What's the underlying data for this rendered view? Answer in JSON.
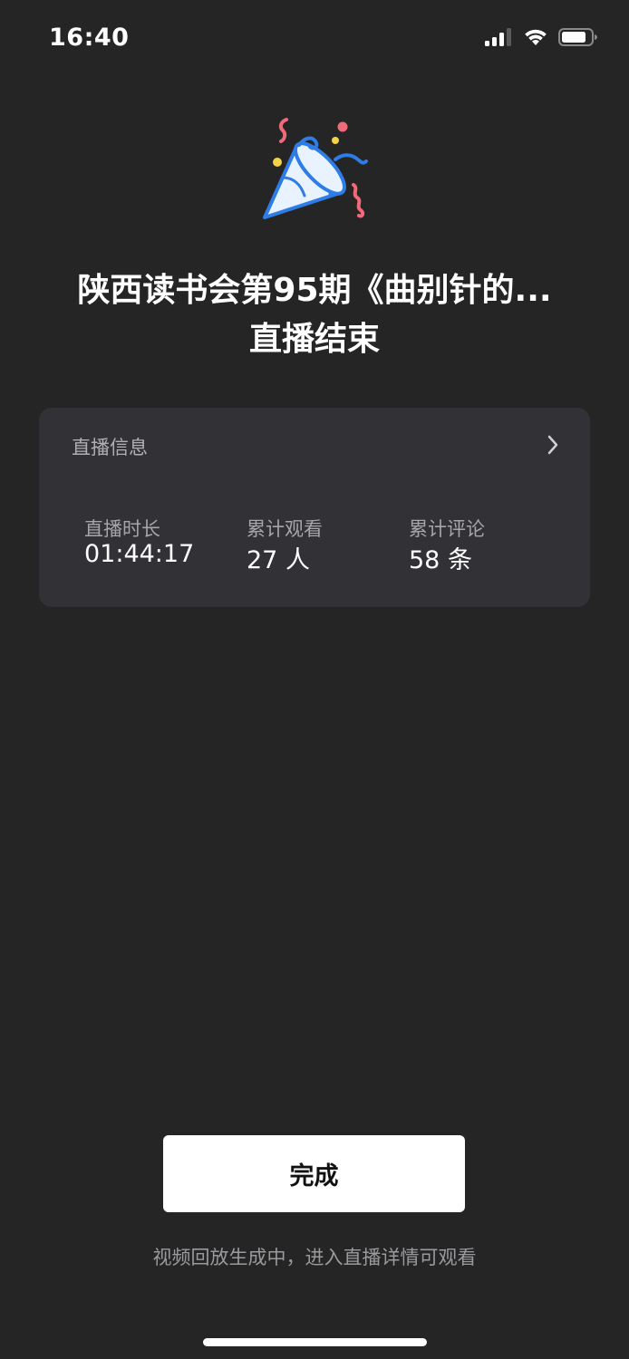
{
  "status_bar": {
    "time": "16:40",
    "icons": [
      "cellular-signal-icon",
      "wifi-icon",
      "battery-icon"
    ]
  },
  "header": {
    "icon": "party-popper-icon",
    "title_line1": "陕西读书会第95期《曲别针的...",
    "title_line2": "直播结束"
  },
  "info_card": {
    "header_label": "直播信息",
    "stats": [
      {
        "label": "直播时长",
        "value": "01:44:17"
      },
      {
        "label": "累计观看",
        "value": "27 人"
      },
      {
        "label": "累计评论",
        "value": "58 条"
      }
    ]
  },
  "actions": {
    "done_label": "完成"
  },
  "footer": {
    "note": "视频回放生成中，进入直播详情可观看"
  },
  "colors": {
    "background": "#252525",
    "card": "#323236",
    "button": "#ffffff",
    "confetti_pink": "#f06b7a",
    "confetti_blue": "#2e7ce6",
    "confetti_yellow": "#f5d14a"
  }
}
